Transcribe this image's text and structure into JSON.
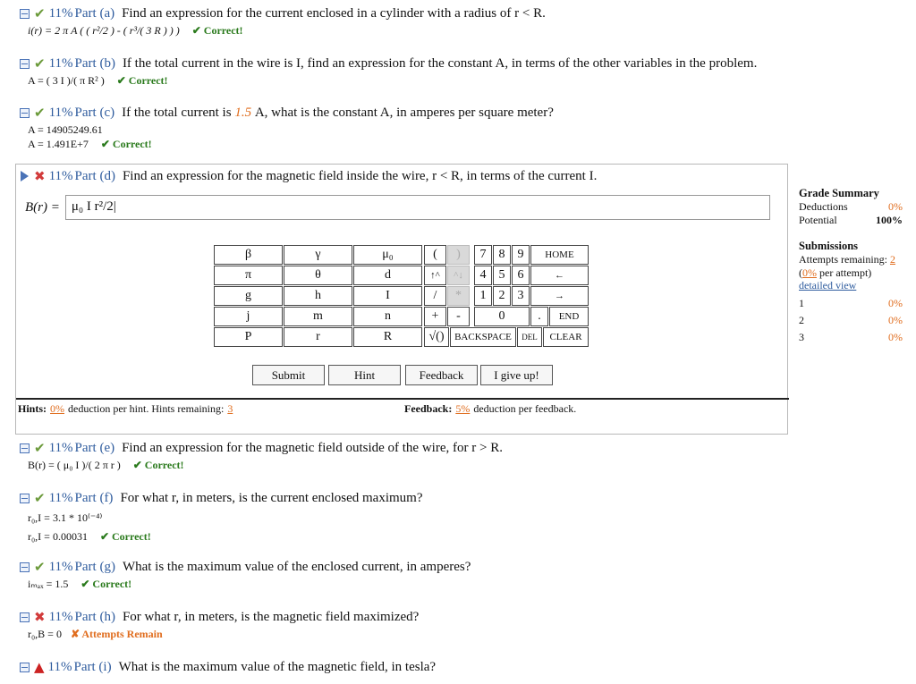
{
  "parts": {
    "a": {
      "pct": "11%",
      "label": "Part (a)",
      "question": "Find an expression for the current enclosed in a cylinder with a radius of r < R.",
      "answer": "i(r) = 2 π A ( ( r²/2 ) - ( r³/( 3 R ) ) )",
      "status": "✔ Correct!"
    },
    "b": {
      "pct": "11%",
      "label": "Part (b)",
      "question": "If the total current in the wire is I, find an expression for the constant A, in terms of the other variables in the problem.",
      "answer": "A = ( 3 I )/( π R² )",
      "status": "✔ Correct!"
    },
    "c": {
      "pct": "11%",
      "label": "Part (c)",
      "question_pre": "If the total current is",
      "value": "1.5",
      "question_post": "A, what is the constant A, in amperes per square meter?",
      "answer1": "A = 14905249.61",
      "answer2": "A = 1.491E+7",
      "status": "✔ Correct!"
    },
    "d": {
      "pct": "11%",
      "label": "Part (d)",
      "question": "Find an expression for the magnetic field inside the wire, r < R, in terms of the current I.",
      "prompt": "B(r) =",
      "input": "μ₀ I r²/2|"
    },
    "e": {
      "pct": "11%",
      "label": "Part (e)",
      "question": "Find an expression for the magnetic field outside of the wire, for r > R.",
      "answer": "B(r) = ( μ₀ I )/( 2 π r )",
      "status": "✔ Correct!"
    },
    "f": {
      "pct": "11%",
      "label": "Part (f)",
      "question": "For what r, in meters, is the current enclosed maximum?",
      "answer1": "r₀,I = 3.1 * 10⁽⁻⁴⁾",
      "answer2": "r₀,I = 0.00031",
      "status": "✔ Correct!"
    },
    "g": {
      "pct": "11%",
      "label": "Part (g)",
      "question": "What is the maximum value of the enclosed current, in amperes?",
      "answer": "iₘₐₓ = 1.5",
      "status": "✔ Correct!"
    },
    "h": {
      "pct": "11%",
      "label": "Part (h)",
      "question": "For what r, in meters, is the magnetic field maximized?",
      "answer": "r₀,B = 0",
      "status": "✘ Attempts Remain"
    },
    "i": {
      "pct": "11%",
      "label": "Part (i)",
      "question": "What is the maximum value of the magnetic field, in tesla?"
    }
  },
  "keypad": {
    "vars": [
      "β",
      "γ",
      "μ₀",
      "π",
      "θ",
      "d",
      "g",
      "h",
      "I",
      "j",
      "m",
      "n",
      "P",
      "r",
      "R"
    ],
    "ops": [
      "(",
      ")",
      "↑^",
      "^↓",
      "/",
      "*",
      "+",
      "-",
      "√()"
    ],
    "digits": [
      "7",
      "8",
      "9",
      "4",
      "5",
      "6",
      "1",
      "2",
      "3",
      "0",
      "."
    ],
    "cmd": [
      "HOME",
      "←",
      "→",
      "END",
      "BACKSPACE",
      "DEL",
      "CLEAR"
    ]
  },
  "buttons": {
    "submit": "Submit",
    "hint": "Hint",
    "feedback": "Feedback",
    "giveup": "I give up!"
  },
  "hints": {
    "label": "Hints:",
    "deduction": "0%",
    "text": "deduction per hint. Hints remaining:",
    "remaining": "3"
  },
  "feedback": {
    "label": "Feedback:",
    "deduction": "5%",
    "text": "deduction per feedback."
  },
  "grade": {
    "title": "Grade Summary",
    "deductions_label": "Deductions",
    "deductions": "0%",
    "potential_label": "Potential",
    "potential": "100%",
    "submissions_title": "Submissions",
    "attempts_label": "Attempts remaining:",
    "attempts": "2",
    "per_attempt_pct": "0%",
    "per_attempt_text": "per attempt)",
    "detailed": "detailed view",
    "rows": [
      {
        "n": "1",
        "v": "0%"
      },
      {
        "n": "2",
        "v": "0%"
      },
      {
        "n": "3",
        "v": "0%"
      }
    ]
  }
}
